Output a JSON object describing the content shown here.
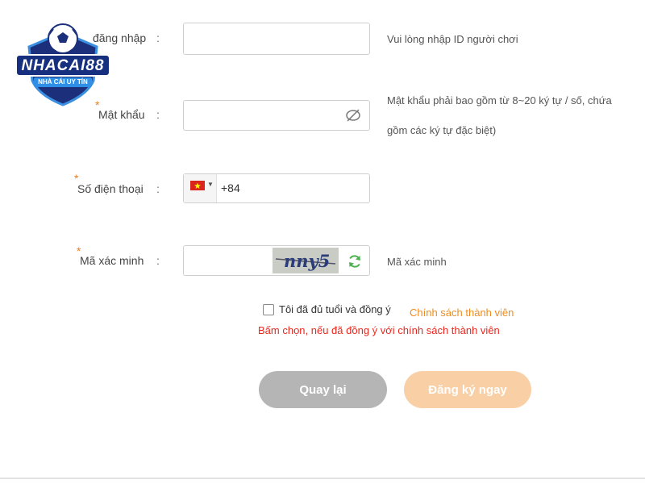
{
  "logo": {
    "name": "NHACAI88",
    "tagline": "NHÀ CÁI UY TÍN"
  },
  "form": {
    "username": {
      "label": "đăng nhập",
      "colon": ":",
      "value": "",
      "hint": "Vui lòng nhập ID người chơi"
    },
    "password": {
      "required_mark": "*",
      "label": "Mật khẩu",
      "colon": ":",
      "value": "",
      "icon": "eye-off-icon",
      "hint_line1": "Mật khẩu phải bao gồm từ 8~20 ký tự / số, chứa",
      "hint_line2": "gồm các ký tự đặc biệt)"
    },
    "phone": {
      "required_mark": "*",
      "label": "Số điện thoại",
      "colon": ":",
      "flag": "vietnam-flag-icon",
      "prefix": "+84"
    },
    "captcha": {
      "required_mark": "*",
      "label": "Mã xác minh",
      "colon": ":",
      "value": "",
      "code": "nny5",
      "refresh_icon": "refresh-icon",
      "hint": "Mã xác minh"
    }
  },
  "agreement": {
    "text": "Tôi đã đủ tuổi và đồng ý",
    "link": "Chính sách thành viên",
    "warning": "Bấm chọn, nếu đã đồng ý với chính sách thành viên"
  },
  "buttons": {
    "back": "Quay lại",
    "register": "Đăng ký ngay"
  },
  "colors": {
    "accent_orange": "#f08c1e",
    "warning_red": "#e8281e",
    "back_btn": "#b5b5b5",
    "register_btn": "#f9cfa5"
  }
}
